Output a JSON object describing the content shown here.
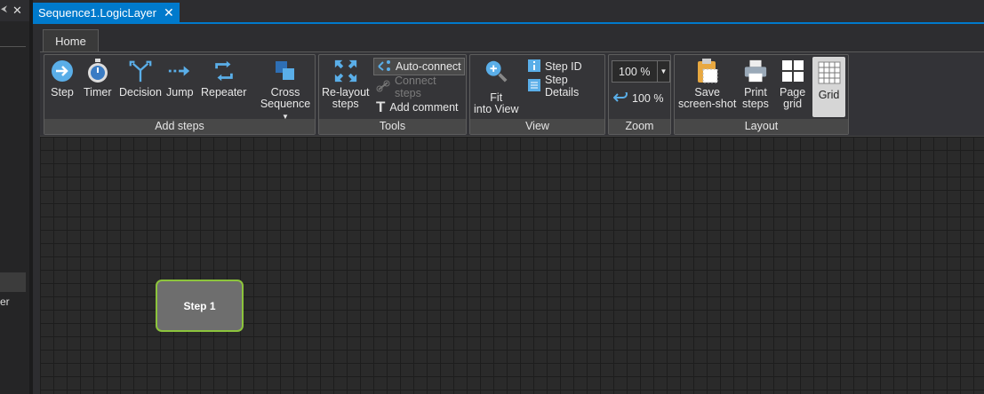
{
  "left_panel": {
    "pin_glyph": "⮜",
    "close_glyph": "✕",
    "partial_text": "er"
  },
  "document_tab": {
    "title": "Sequence1.LogicLayer",
    "close_glyph": "✕"
  },
  "ribbon": {
    "tab_home": "Home",
    "groups": {
      "add_steps": {
        "title": "Add steps",
        "step": "Step",
        "timer": "Timer",
        "decision": "Decision",
        "jump": "Jump",
        "repeater": "Repeater",
        "cross_line1": "Cross",
        "cross_line2": "Sequence"
      },
      "tools": {
        "title": "Tools",
        "relayout_line1": "Re-layout",
        "relayout_line2": "steps",
        "auto_connect": "Auto-connect",
        "connect_steps": "Connect steps",
        "add_comment": "Add comment"
      },
      "view": {
        "title": "View",
        "fit_line1": "Fit",
        "fit_line2": "into View",
        "step_id": "Step ID",
        "step_details": "Step Details"
      },
      "zoom": {
        "title": "Zoom",
        "zoom_value": "100 %",
        "reset_label": "100 %"
      },
      "layout": {
        "title": "Layout",
        "save_line1": "Save",
        "save_line2": "screen-shot",
        "print_line1": "Print",
        "print_line2": "steps",
        "page_line1": "Page",
        "page_line2": "grid",
        "grid": "Grid"
      }
    }
  },
  "canvas": {
    "step_node_label": "Step 1"
  },
  "colors": {
    "accent": "#007acc",
    "node_border": "#8cc43c",
    "node_fill": "#6e6e6e"
  }
}
